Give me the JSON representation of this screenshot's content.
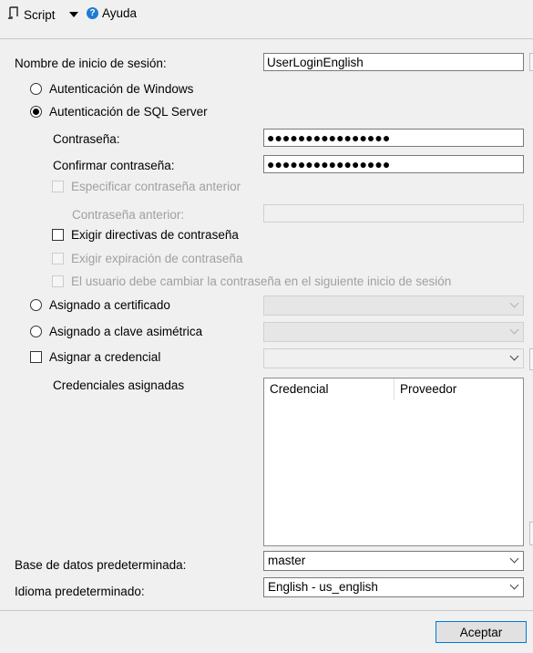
{
  "toolbar": {
    "script_label": "Script",
    "help_label": "Ayuda"
  },
  "form": {
    "login_name_label": "Nombre de inicio de sesión:",
    "login_name_value": "UserLoginEnglish",
    "windows_auth_label": "Autenticación de Windows",
    "sql_auth_label": "Autenticación de SQL Server",
    "password_label": "Contraseña:",
    "password_value": "●●●●●●●●●●●●●●●●",
    "confirm_password_label": "Confirmar contraseña:",
    "confirm_password_value": "●●●●●●●●●●●●●●●●",
    "specify_old_password_label": "Especificar contraseña anterior",
    "old_password_label": "Contraseña anterior:",
    "enforce_policy_label": "Exigir directivas de contraseña",
    "enforce_expiration_label": "Exigir expiración de contraseña",
    "must_change_label": "El usuario debe cambiar la contraseña en el siguiente inicio de sesión",
    "mapped_cert_label": "Asignado a certificado",
    "mapped_asym_key_label": "Asignado a clave asimétrica",
    "map_credential_label": "Asignar a credencial",
    "mapped_credentials_label": "Credenciales asignadas",
    "grid_columns": [
      "Credencial",
      "Proveedor"
    ],
    "default_db_label": "Base de datos predeterminada:",
    "default_db_value": "master",
    "default_lang_label": "Idioma predeterminado:",
    "default_lang_value": "English - us_english"
  },
  "footer": {
    "accept_label": "Aceptar"
  }
}
